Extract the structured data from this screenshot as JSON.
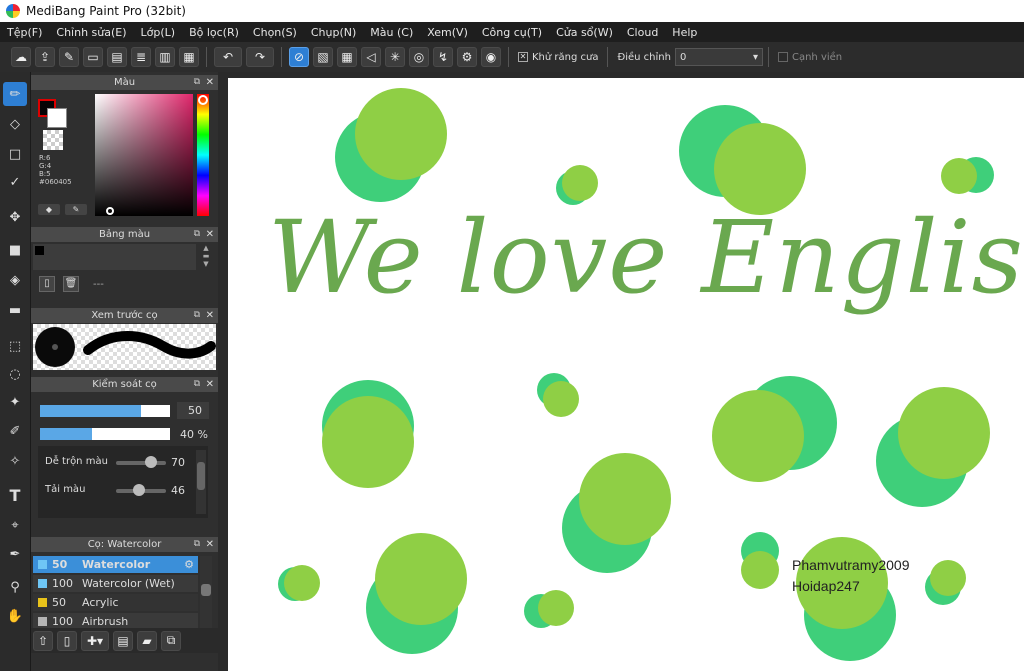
{
  "window": {
    "title": "MediBang Paint Pro (32bit)"
  },
  "menu": [
    "Tệp(F)",
    "Chỉnh sửa(E)",
    "Lớp(L)",
    "Bộ lọc(R)",
    "Chọn(S)",
    "Chụp(N)",
    "Màu (C)",
    "Xem(V)",
    "Công cụ(T)",
    "Cửa sổ(W)",
    "Cloud",
    "Help"
  ],
  "toolbar": {
    "antialias_label": "Khử răng cưa",
    "adjust_label": "Điều chỉnh",
    "adjust_value": "0",
    "edge_label": "Cạnh viền"
  },
  "panels": {
    "color": {
      "title": "Màu",
      "r": "R:6",
      "g": "G:4",
      "b": "B:5",
      "hex": "#060405"
    },
    "palette": {
      "title": "Bảng màu",
      "dash": "---"
    },
    "preview": {
      "title": "Xem trước cọ"
    },
    "control": {
      "title": "Kiểm soát cọ",
      "size_value": "50",
      "opacity_value": "40 %",
      "size_fill": 0.78,
      "opacity_fill": 0.4,
      "blend_label": "Dễ trộn màu",
      "blend_value": "70",
      "blend_level": 0.7,
      "reload_label": "Tải màu",
      "reload_value": "46",
      "reload_level": 0.46
    },
    "brushes": {
      "title": "Cọ: Watercolor",
      "items": [
        {
          "size": "50",
          "name": "Watercolor",
          "color": "#6ec6f5",
          "selected": true
        },
        {
          "size": "100",
          "name": "Watercolor (Wet)",
          "color": "#6ec6f5",
          "selected": false
        },
        {
          "size": "50",
          "name": "Acrylic",
          "color": "#e8c21a",
          "selected": false
        },
        {
          "size": "100",
          "name": "Airbrush",
          "color": "#b5b5b5",
          "selected": false
        }
      ]
    }
  },
  "canvas": {
    "headline": "We love English",
    "credit1": "Phamvutramy2009",
    "credit2": "Hoidap247",
    "colors": {
      "light_green": "#8fcf45",
      "teal_green": "#3fcf7a",
      "text_green": "#6aa84f"
    }
  }
}
